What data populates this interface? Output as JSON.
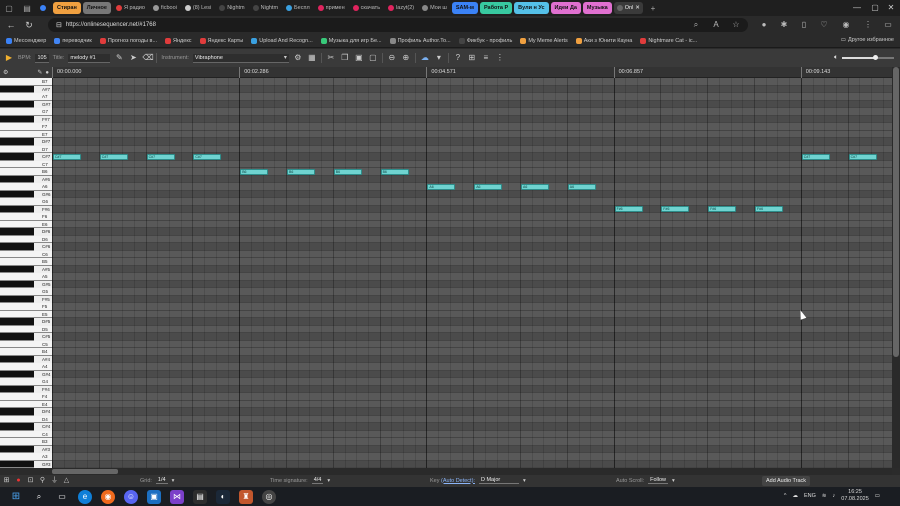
{
  "browser": {
    "tabs": [
      {
        "label": "",
        "color": "#3b82f6",
        "group": false
      },
      {
        "label": "Стиран",
        "color": "#f0a040",
        "group": true
      },
      {
        "label": "Личное",
        "color": "#777777",
        "group": true
      },
      {
        "label": "Я радио",
        "color": "#e03c3c",
        "group": false
      },
      {
        "label": "ficbooi",
        "color": "#999999",
        "group": false
      },
      {
        "label": "(8) Lesi",
        "color": "#cccccc",
        "group": false
      },
      {
        "label": "Nightm",
        "color": "#444444",
        "group": false
      },
      {
        "label": "Nightm",
        "color": "#444444",
        "group": false
      },
      {
        "label": "Беспл",
        "color": "#3aa0e0",
        "group": false
      },
      {
        "label": "примен",
        "color": "#e0245e",
        "group": false
      },
      {
        "label": "скачать",
        "color": "#e0245e",
        "group": false
      },
      {
        "label": "lazyt(2)",
        "color": "#e0245e",
        "group": false
      },
      {
        "label": "Мои ш",
        "color": "#888888",
        "group": false
      },
      {
        "label": "SAM-м",
        "color": "#3b82f6",
        "group": true
      },
      {
        "label": "Работа Р",
        "color": "#38c9a0",
        "group": true
      },
      {
        "label": "Вули н Ус",
        "color": "#55c0e8",
        "group": true
      },
      {
        "label": "Идеи Да",
        "color": "#e070d0",
        "group": true
      },
      {
        "label": "Музыка",
        "color": "#e070d0",
        "group": true
      },
      {
        "label": "Onl",
        "color": "#666666",
        "group": false,
        "active": true
      }
    ],
    "url": "https://onlinesequencer.net/#1768",
    "bookmarks": [
      {
        "label": "Мессенджер",
        "color": "#3b82f6"
      },
      {
        "label": "переводчик",
        "color": "#4285f4"
      },
      {
        "label": "Прогноз погоды в...",
        "color": "#e03c3c"
      },
      {
        "label": "Яндекс",
        "color": "#e03c3c"
      },
      {
        "label": "Яндекс Карты",
        "color": "#e03c3c"
      },
      {
        "label": "Upload And Recogn...",
        "color": "#3aa0e0"
      },
      {
        "label": "Музыка для игр Бе...",
        "color": "#38c97a"
      },
      {
        "label": "Профиль Author.To...",
        "color": "#888888"
      },
      {
        "label": "Фикбук - профиль",
        "color": "#444444"
      },
      {
        "label": "My Meme Alerts",
        "color": "#f0a040"
      },
      {
        "label": "Аки з Юнити Кауна",
        "color": "#f0a040"
      },
      {
        "label": "Nightmare Cat - ic...",
        "color": "#e03c3c"
      }
    ],
    "other_bookmarks": "Другое избранное"
  },
  "toolbar": {
    "bpm_label": "BPM:",
    "bpm_value": "105",
    "title_label": "Title:",
    "title_value": "melody #1",
    "instrument_label": "Instrument:",
    "instrument_value": "Vibraphone"
  },
  "ruler": {
    "times": [
      "00:00.000",
      "00:02.286",
      "00:04.571",
      "00:06.857",
      "00:09.143"
    ]
  },
  "notes": [
    {
      "label": "C#7",
      "pitch": "C#7",
      "start": 0,
      "length": 1
    },
    {
      "label": "C#7",
      "pitch": "C#7",
      "start": 4,
      "length": 1
    },
    {
      "label": "C#7",
      "pitch": "C#7",
      "start": 8,
      "length": 1
    },
    {
      "label": "C#7",
      "pitch": "C#7",
      "start": 12,
      "length": 1
    },
    {
      "label": "B6",
      "pitch": "B6",
      "start": 16,
      "length": 1
    },
    {
      "label": "B6",
      "pitch": "B6",
      "start": 20,
      "length": 1
    },
    {
      "label": "B6",
      "pitch": "B6",
      "start": 24,
      "length": 1
    },
    {
      "label": "B6",
      "pitch": "B6",
      "start": 28,
      "length": 1
    },
    {
      "label": "A6",
      "pitch": "A6",
      "start": 32,
      "length": 1
    },
    {
      "label": "A6",
      "pitch": "A6",
      "start": 36,
      "length": 1
    },
    {
      "label": "A6",
      "pitch": "A6",
      "start": 40,
      "length": 1
    },
    {
      "label": "A6",
      "pitch": "A6",
      "start": 44,
      "length": 1
    },
    {
      "label": "F#6",
      "pitch": "F#6",
      "start": 48,
      "length": 1
    },
    {
      "label": "F#6",
      "pitch": "F#6",
      "start": 52,
      "length": 1
    },
    {
      "label": "F#6",
      "pitch": "F#6",
      "start": 56,
      "length": 1
    },
    {
      "label": "F#6",
      "pitch": "F#6",
      "start": 60,
      "length": 1
    },
    {
      "label": "C#7",
      "pitch": "C#7",
      "start": 64,
      "length": 1
    },
    {
      "label": "C#7",
      "pitch": "C#7",
      "start": 68,
      "length": 1
    }
  ],
  "statusbar": {
    "grid_label": "Grid:",
    "grid_value": "1/4",
    "time_sig_label": "Time signature:",
    "time_sig_value": "4/4",
    "key_label": "Key",
    "key_auto": "(Auto Detect):",
    "key_value": "D Major",
    "autoscroll_label": "Auto Scroll:",
    "autoscroll_value": "Follow",
    "add_audio_track": "Add Audio Track"
  },
  "taskbar": {
    "lang": "ENG",
    "time": "16:25",
    "date": "07.08.2025"
  },
  "icons": {
    "note_color": "#6fd3d0",
    "rec_color": "#ee3333"
  }
}
